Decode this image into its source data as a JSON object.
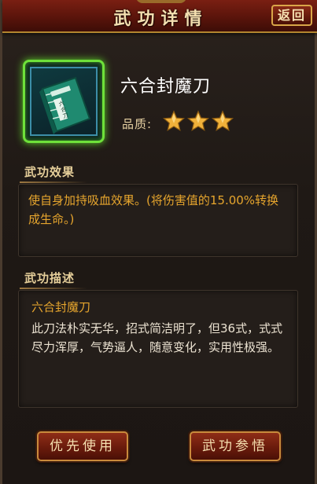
{
  "header": {
    "title": "武功详情",
    "back_label": "返回"
  },
  "skill": {
    "name": "六合封魔刀",
    "quality_label": "品质:",
    "quality_stars": 3,
    "icon": "green-martial-arts-book-icon"
  },
  "effect": {
    "section_label": "武功效果",
    "text": "使自身加持吸血效果。(将伤害值的15.00%转换成生命。)"
  },
  "description": {
    "section_label": "武功描述",
    "title": "六合封魔刀",
    "text": "此刀法朴实无华，招式简洁明了，但36式，式式尽力浑厚，气势逼人，随意变化，实用性极强。"
  },
  "buttons": {
    "use_label": "优先使用",
    "comprehend_label": "武功参悟"
  },
  "colors": {
    "accent_gold": "#e6a52d",
    "header_red": "#6a170c",
    "icon_glow": "#6ee13a"
  }
}
